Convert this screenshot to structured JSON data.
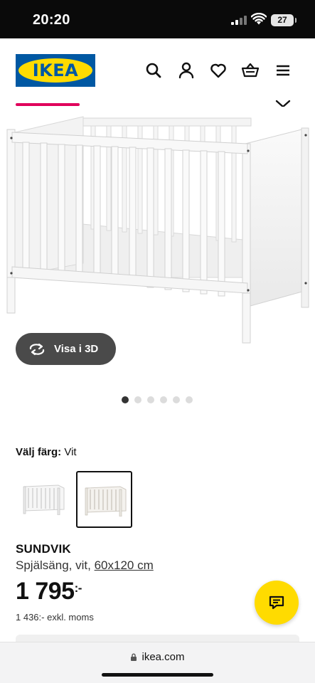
{
  "status_bar": {
    "time": "20:20",
    "battery": "27",
    "icons": [
      "signal-icon",
      "wifi-icon",
      "battery-icon"
    ]
  },
  "header": {
    "logo_text": "IKEA",
    "brand_colors": {
      "blue": "#0058a3",
      "yellow": "#ffdb00",
      "accent_pink": "#e0005b"
    },
    "icons": [
      "search-icon",
      "account-icon",
      "heart-icon",
      "basket-icon",
      "menu-icon",
      "chevron-down-icon"
    ]
  },
  "gallery": {
    "view_3d_label": "Visa i 3D",
    "slide_count": 6,
    "active_slide": 1
  },
  "color_selector": {
    "label": "Välj färg:",
    "value": "Vit",
    "options": [
      {
        "name": "crib-variant-1",
        "selected": false
      },
      {
        "name": "crib-variant-2",
        "selected": true
      }
    ]
  },
  "product": {
    "name": "SUNDVIK",
    "description": "Spjälsäng, vit,",
    "size_link": "60x120 cm",
    "price_main": "1 795",
    "price_suffix": ":-",
    "price_excl": "1 436:- exkl. moms"
  },
  "browser": {
    "url": "ikea.com"
  }
}
